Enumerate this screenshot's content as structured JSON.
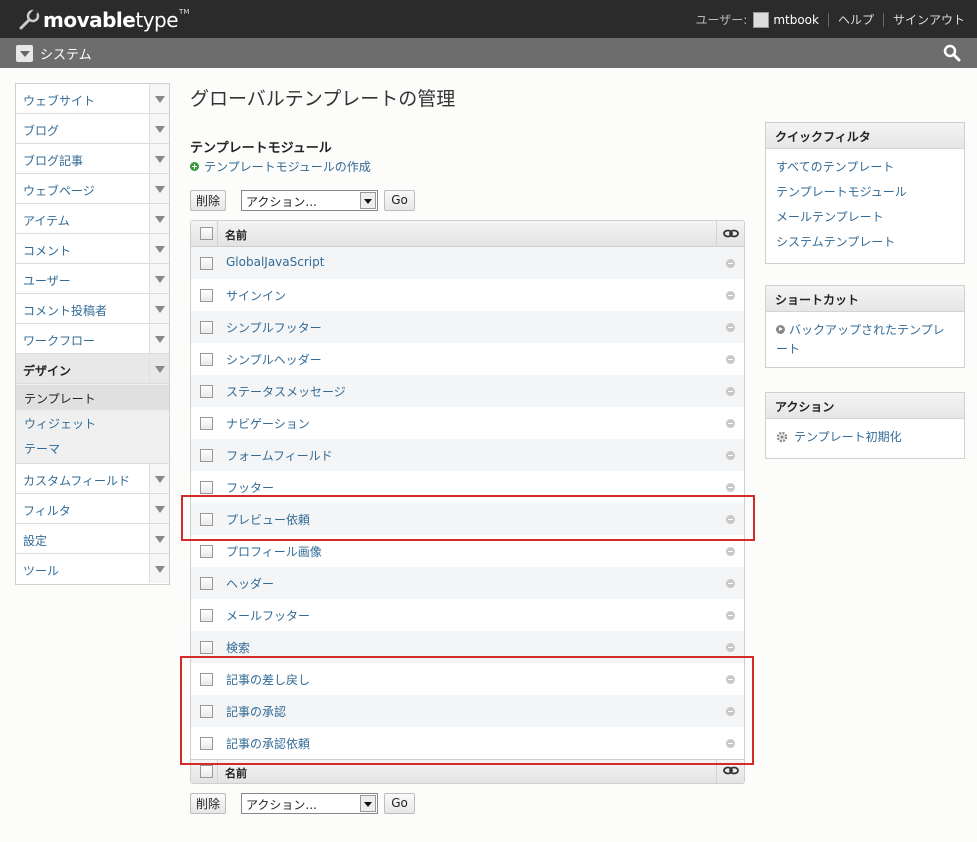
{
  "header": {
    "brand_bold": "movable",
    "brand_light": "type",
    "tm": "TM",
    "user_label": "ユーザー:",
    "username": "mtbook",
    "help": "ヘルプ",
    "signout": "サインアウト"
  },
  "sysbar": {
    "title": "システム"
  },
  "leftnav": {
    "items": [
      {
        "label": "ウェブサイト"
      },
      {
        "label": "ブログ"
      },
      {
        "label": "ブログ記事"
      },
      {
        "label": "ウェブページ"
      },
      {
        "label": "アイテム"
      },
      {
        "label": "コメント"
      },
      {
        "label": "ユーザー"
      },
      {
        "label": "コメント投稿者"
      },
      {
        "label": "ワークフロー"
      },
      {
        "label": "デザイン"
      },
      {
        "label": "カスタムフィールド"
      },
      {
        "label": "フィルタ"
      },
      {
        "label": "設定"
      },
      {
        "label": "ツール"
      }
    ],
    "design_sub": [
      "テンプレート",
      "ウィジェット",
      "テーマ"
    ]
  },
  "main": {
    "page_title": "グローバルテンプレートの管理",
    "section_title": "テンプレートモジュール",
    "create_link": "テンプレートモジュールの作成",
    "delete_label": "削除",
    "action_select": "アクション...",
    "go_label": "Go",
    "col_name": "名前",
    "rows": [
      "GlobalJavaScript",
      "サインイン",
      "シンプルフッター",
      "シンプルヘッダー",
      "ステータスメッセージ",
      "ナビゲーション",
      "フォームフィールド",
      "フッター",
      "プレビュー依頼",
      "プロフィール画像",
      "ヘッダー",
      "メールフッター",
      "検索",
      "記事の差し戻し",
      "記事の承認",
      "記事の承認依頼"
    ]
  },
  "sidebar": {
    "quickfilter_title": "クイックフィルタ",
    "quickfilters": [
      "すべてのテンプレート",
      "テンプレートモジュール",
      "メールテンプレート",
      "システムテンプレート"
    ],
    "shortcut_title": "ショートカット",
    "shortcut_link": "バックアップされたテンプレート",
    "action_title": "アクション",
    "action_link": "テンプレート初期化"
  },
  "colors": {
    "highlight": "#d32a2a",
    "link": "#336b96",
    "header_bg": "#2b2b2b",
    "sysbar_bg": "#6d6d6d"
  }
}
